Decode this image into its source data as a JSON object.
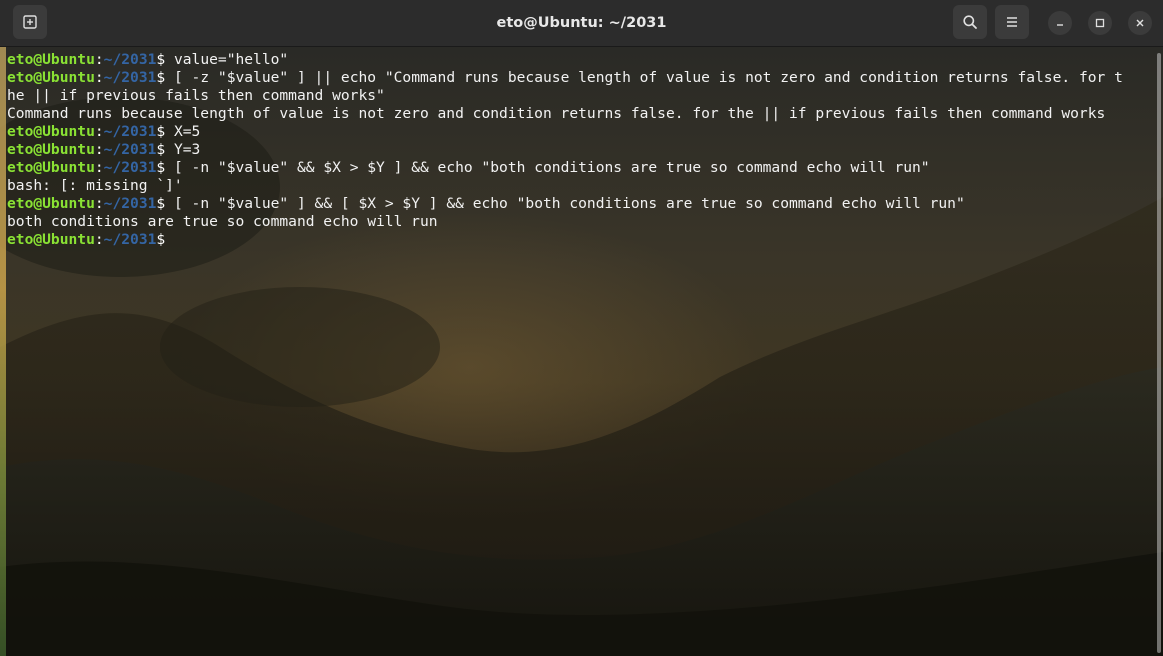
{
  "window": {
    "title": "eto@Ubuntu: ~/2031"
  },
  "icons": {
    "new_tab": "new-tab-icon",
    "search": "search-icon",
    "menu": "hamburger-menu-icon",
    "minimize": "minimize-icon",
    "maximize": "maximize-icon",
    "close": "close-icon"
  },
  "colors": {
    "prompt_user": "#8ae234",
    "prompt_path": "#3465a4",
    "text": "#f2f2f2",
    "titlebar": "#2c2c2c"
  },
  "prompt": {
    "user_host": "eto@Ubuntu",
    "separator": ":",
    "path": "~/2031",
    "symbol": "$"
  },
  "lines": [
    {
      "type": "cmd",
      "text": " value=\"hello\""
    },
    {
      "type": "cmd",
      "text": " [ -z \"$value\" ] || echo \"Command runs because length of value is not zero and condition returns false. for t"
    },
    {
      "type": "out",
      "text": "he || if previous fails then command works\""
    },
    {
      "type": "out",
      "text": "Command runs because length of value is not zero and condition returns false. for the || if previous fails then command works"
    },
    {
      "type": "cmd",
      "text": " X=5"
    },
    {
      "type": "cmd",
      "text": " Y=3"
    },
    {
      "type": "cmd",
      "text": " [ -n \"$value\" && $X > $Y ] && echo \"both conditions are true so command echo will run\""
    },
    {
      "type": "out",
      "text": "bash: [: missing `]'"
    },
    {
      "type": "cmd",
      "text": " [ -n \"$value\" ] && [ $X > $Y ] && echo \"both conditions are true so command echo will run\""
    },
    {
      "type": "out",
      "text": "both conditions are true so command echo will run"
    },
    {
      "type": "cmd",
      "text": ""
    }
  ]
}
